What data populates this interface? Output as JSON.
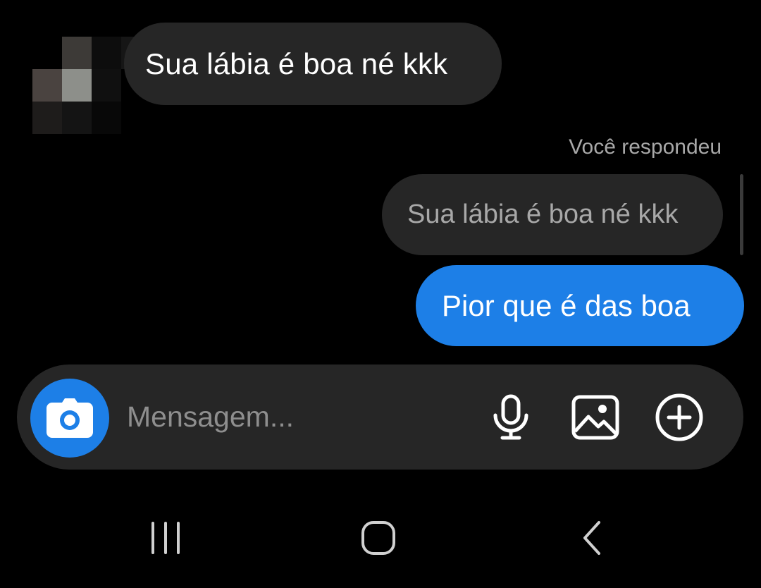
{
  "conversation": {
    "incoming_message": "Sua lábia é boa né kkk",
    "reply_label": "Você respondeu",
    "reply_quote": "Sua lábia é boa né kkk",
    "outgoing_message": "Pior que é das boa"
  },
  "composer": {
    "placeholder": "Mensagem...",
    "value": "",
    "icons": {
      "camera": "camera-icon",
      "microphone": "microphone-icon",
      "gallery": "gallery-icon",
      "add": "plus-circle-icon"
    }
  },
  "navbar": {
    "recents": "recent-apps-icon",
    "home": "home-icon",
    "back": "back-icon"
  },
  "colors": {
    "background": "#000000",
    "bubble_gray": "#262626",
    "accent_blue": "#1d7fe7",
    "muted_text": "#a8a8a8"
  }
}
